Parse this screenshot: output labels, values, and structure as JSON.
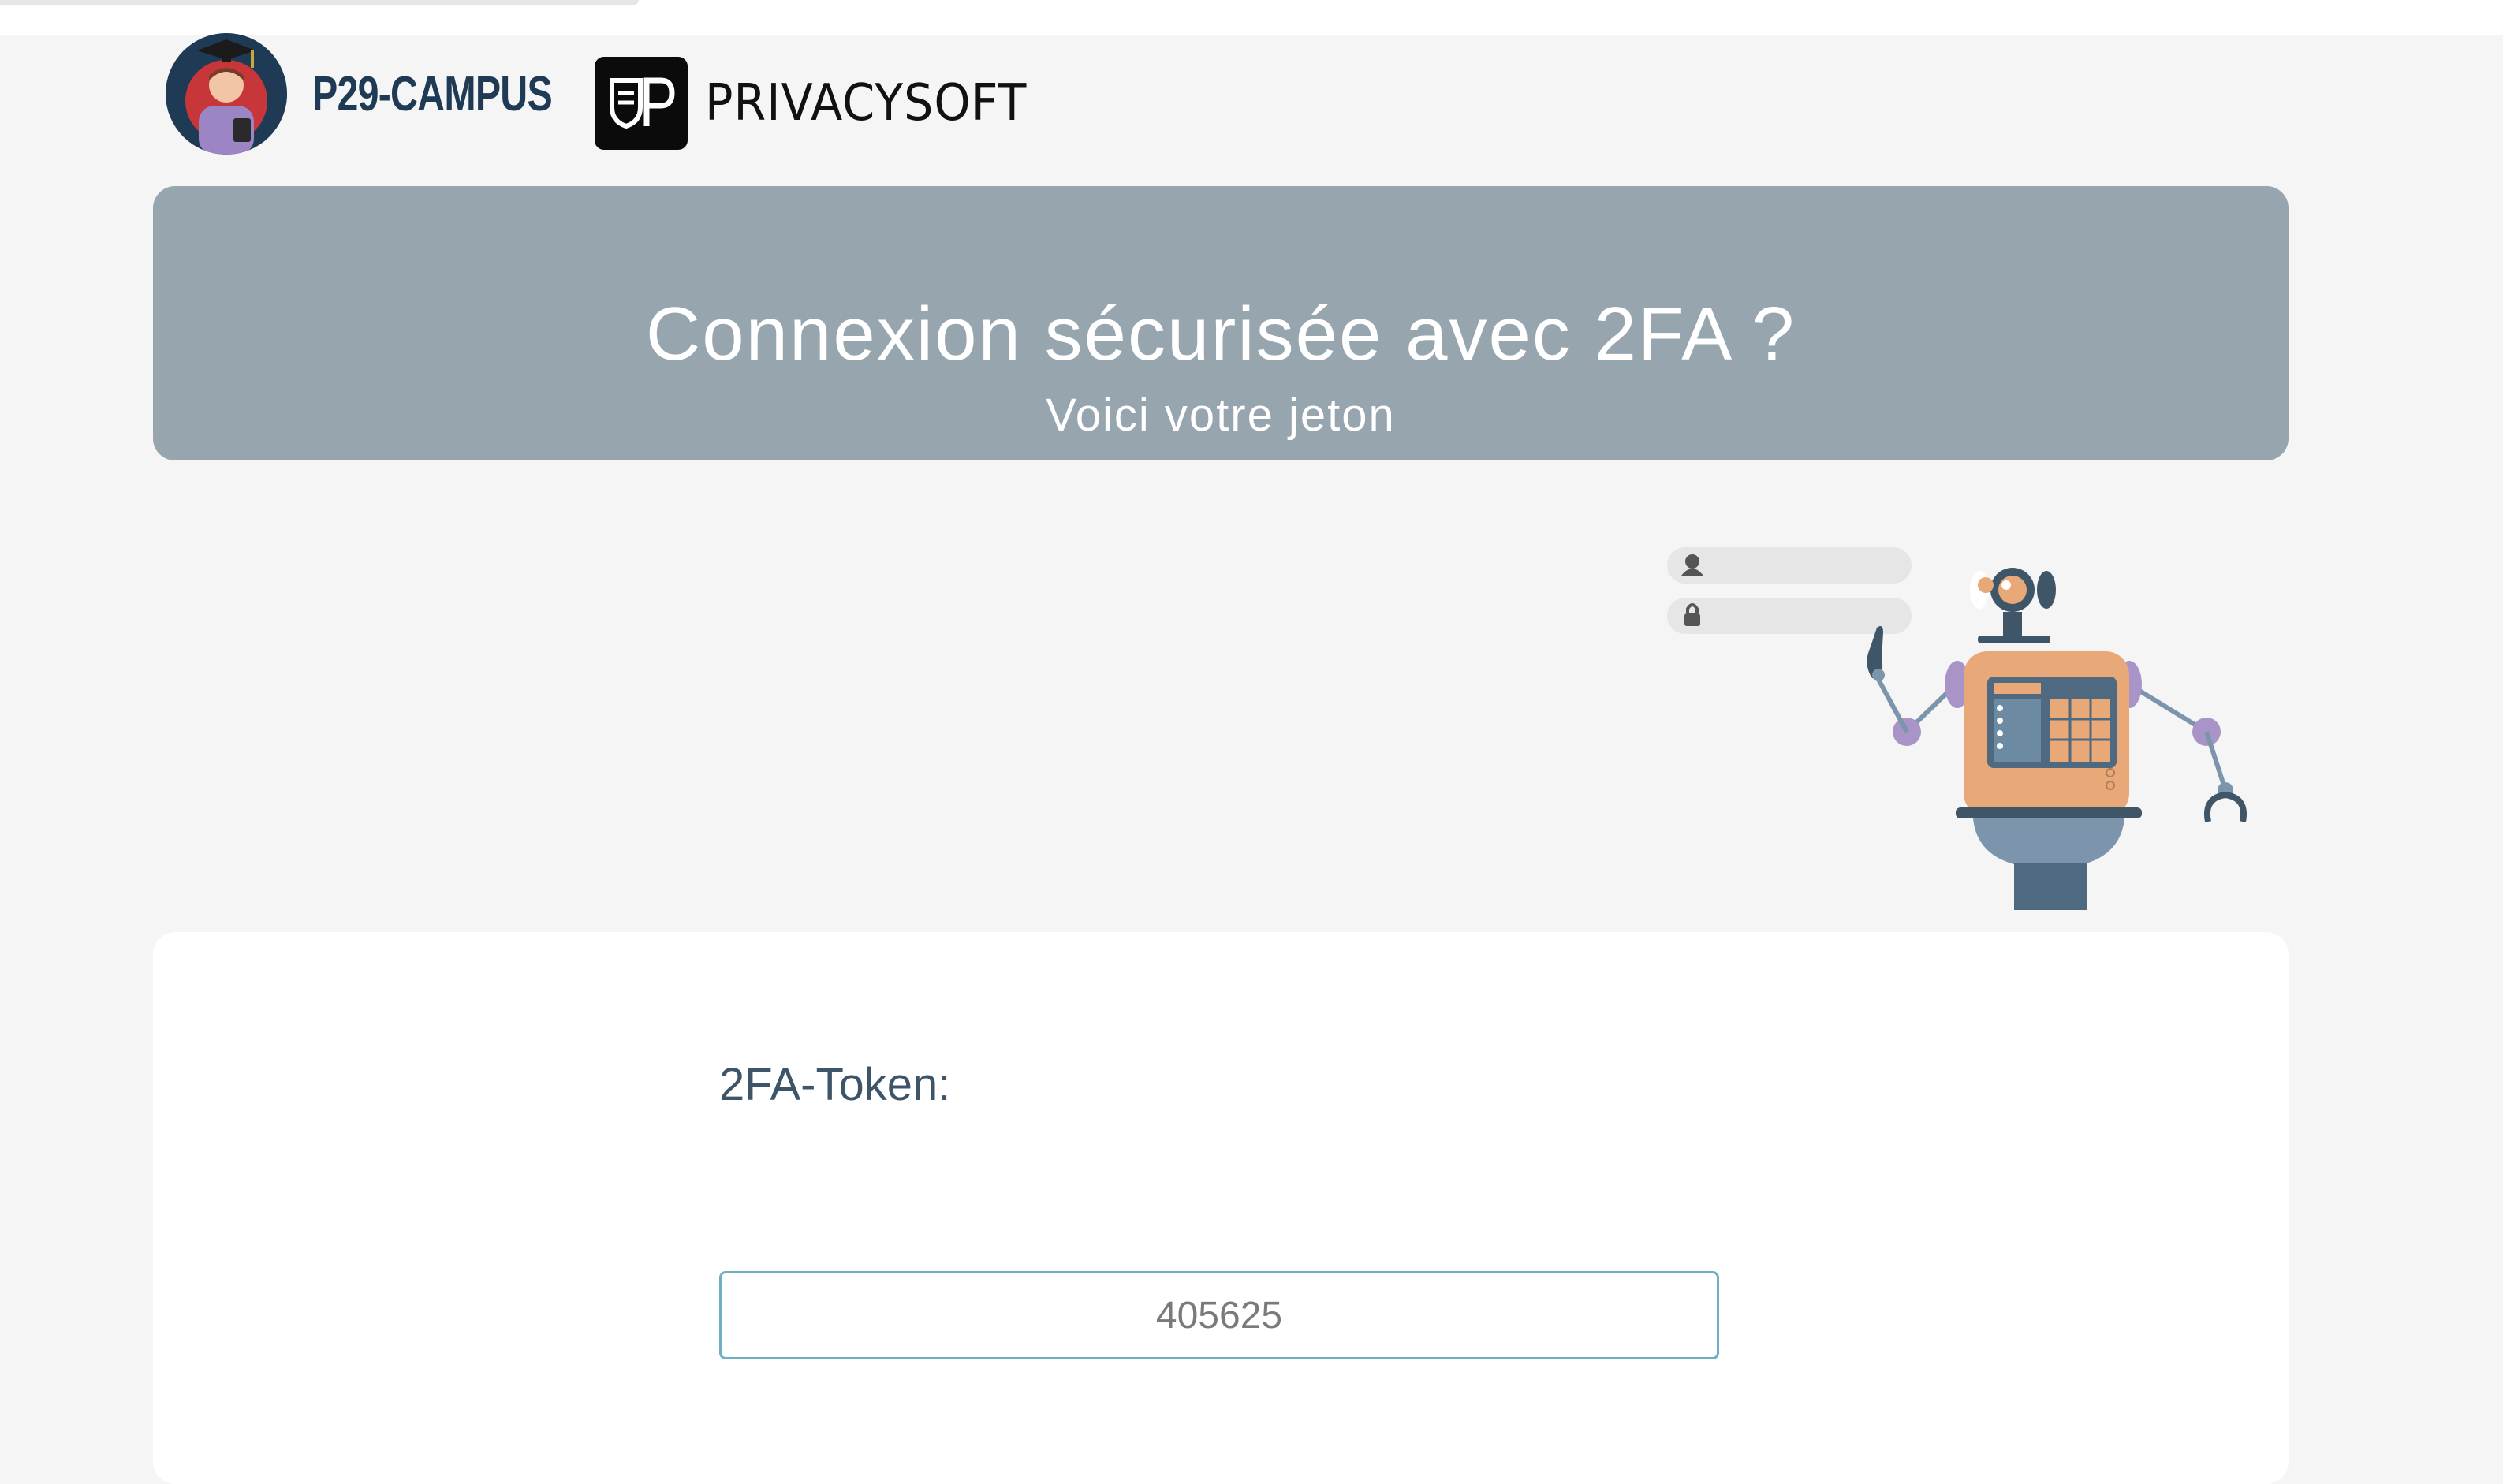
{
  "header": {
    "campus_logo_text": "P29-CAMPUS",
    "privacy_logo_text": "PRIVACYSOFT"
  },
  "banner": {
    "title": "Connexion sécurisée avec 2FA ?",
    "subtitle": "Voici votre jeton"
  },
  "form": {
    "token_label": "2FA-Token:",
    "token_value": "405625"
  },
  "colors": {
    "banner_bg": "#97a5ae",
    "page_bg": "#f5f5f5",
    "label_text": "#3e5468",
    "input_border": "#6fb0c2",
    "robot_body": "#e8a878",
    "robot_accent": "#4f6a80"
  }
}
